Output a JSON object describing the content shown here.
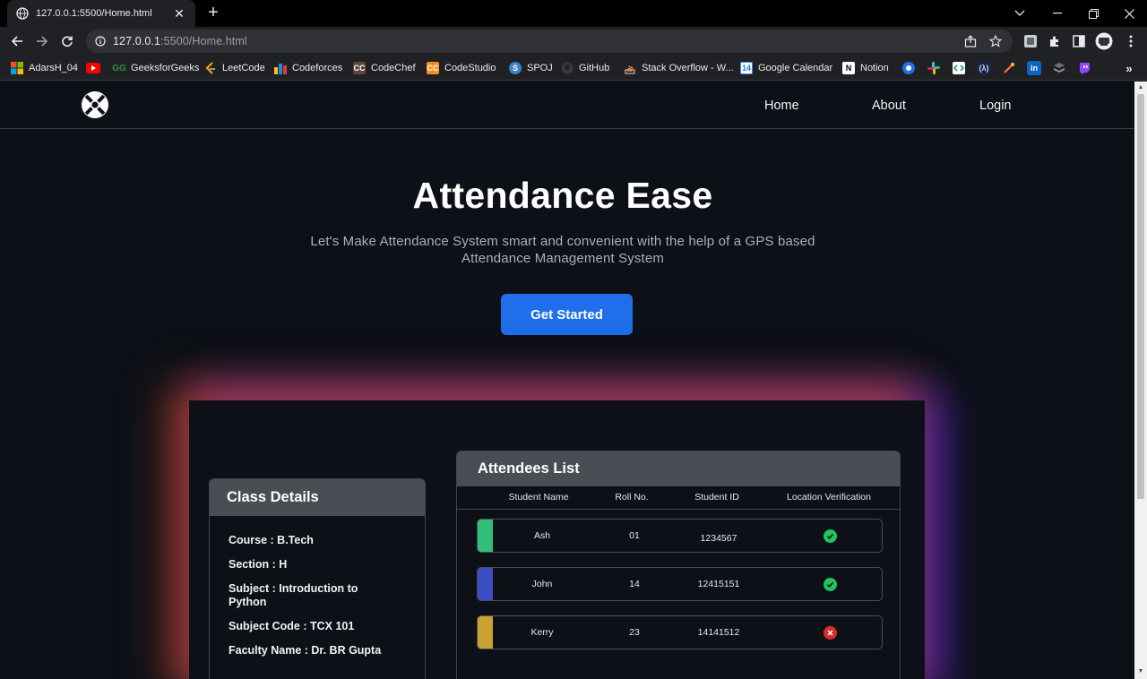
{
  "browser": {
    "tab_title": "127.0.0.1:5500/Home.html",
    "url_host": "127.0.0.1",
    "url_rest": ":5500/Home.html",
    "bookmarks": [
      {
        "label": "AdarsH_04"
      },
      {
        "label": "GeeksforGeeks"
      },
      {
        "label": "LeetCode"
      },
      {
        "label": "Codeforces"
      },
      {
        "label": "CodeChef"
      },
      {
        "label": "CodeStudio"
      },
      {
        "label": "SPOJ"
      },
      {
        "label": "GitHub"
      },
      {
        "label": "Stack Overflow - W..."
      },
      {
        "label": "Google Calendar"
      },
      {
        "label": "Notion"
      }
    ],
    "more_bookmarks": "»"
  },
  "site": {
    "nav": {
      "home": "Home",
      "about": "About",
      "login": "Login"
    },
    "hero": {
      "title": "Attendance Ease",
      "subtitle": "Let's Make Attendance System smart and convenient with the help of a GPS based Attendance Management System",
      "cta": "Get Started"
    },
    "class_details": {
      "title": "Class Details",
      "course": "Course : B.Tech",
      "section": "Section : H",
      "subject": "Subject  : Introduction to Python",
      "subject_code": "Subject Code : TCX 101",
      "faculty": "Faculty Name : Dr. BR Gupta"
    },
    "attendees": {
      "title": "Attendees List",
      "columns": [
        "Student Name",
        "Roll No.",
        "Student ID",
        "Location Verification"
      ],
      "rows": [
        {
          "name": "Ash",
          "roll": "01",
          "id": "1234567",
          "verified": true,
          "color": "#2fbf7a"
        },
        {
          "name": "John",
          "roll": "14",
          "id": "12415151",
          "verified": true,
          "color": "#3b4fc4"
        },
        {
          "name": "Kerry",
          "roll": "23",
          "id": "14141512",
          "verified": false,
          "color": "#c9a22f"
        }
      ]
    }
  },
  "colors": {
    "accent": "#1f6feb",
    "verified": "#22c55e",
    "rejected": "#d92b2b",
    "page_bg": "#0d1117"
  }
}
